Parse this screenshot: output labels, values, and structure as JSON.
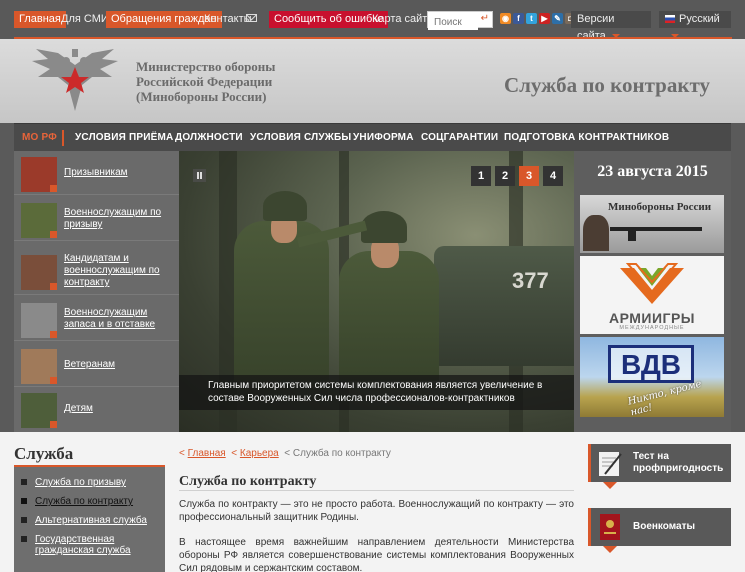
{
  "topbar": {
    "home": "Главная",
    "media": "Для СМИ",
    "appeals": "Обращения граждан",
    "contacts": "Контакты",
    "report_error": "Сообщить об ошибке",
    "sitemap": "Карта сайта",
    "search_placeholder": "Поиск",
    "versions": "Версии сайта",
    "language": "Русский",
    "social_icons": [
      "rss-icon",
      "facebook-icon",
      "twitter-icon",
      "youtube-icon",
      "livejournal-icon",
      "instagram-icon"
    ]
  },
  "header": {
    "ministry_lines": [
      "Министерство обороны",
      "Российской Федерации",
      "(Минобороны России)"
    ],
    "section_title": "Служба по контракту"
  },
  "nav": {
    "items": [
      "МО РФ",
      "УСЛОВИЯ ПРИЁМА",
      "ДОЛЖНОСТИ",
      "УСЛОВИЯ СЛУЖБЫ",
      "УНИФОРМА",
      "СОЦГАРАНТИИ",
      "ПОДГОТОВКА КОНТРАКТНИКОВ"
    ]
  },
  "categories": [
    "Призывникам",
    "Военнослужащим по призыву",
    "Кандидатам и военнослужащим по контракту",
    "Военнослужащим запаса и в отставке",
    "Ветеранам",
    "Детям"
  ],
  "slider": {
    "pages": [
      "1",
      "2",
      "3",
      "4"
    ],
    "active_page": "3",
    "vehicle_number": "377",
    "caption": "Главным приоритетом системы комплектования является увеличение в составе Вооруженных Сил числа профессионалов-контрактников"
  },
  "right": {
    "date": "23 августа 2015",
    "banner1_text": "Минобороны России",
    "banner2_name": "АРМИИГРЫ",
    "banner2_sub": "МЕЖДУНАРОДНЫЕ",
    "banner3_vdv": "ВДВ",
    "banner3_slogan": "Никто, кроме нас!"
  },
  "sidebar": {
    "title": "Служба",
    "items": [
      "Служба по призыву",
      "Служба по контракту",
      "Альтернативная служба",
      "Государственная гражданская служба"
    ],
    "current_index": 1
  },
  "breadcrumb": {
    "home": "Главная",
    "career": "Карьера",
    "current": "Служба по контракту"
  },
  "content": {
    "title": "Служба по контракту",
    "para1": "Служба по контракту — это не просто работа. Военнослужащий по контракту — это профессиональный защитник Родины.",
    "para2": "В настоящее время важнейшим направлением деятельности Министерства обороны РФ является совершенствование системы комплектования Вооруженных Сил рядовым и сержантским составом."
  },
  "widgets": {
    "test": "Тест на профпригодность",
    "enlistment": "Военкоматы"
  },
  "colors": {
    "accent": "#d9572a",
    "alert_red": "#c8102e",
    "topbar_bg": "#595959",
    "nav_bg": "#4a4a4a"
  }
}
